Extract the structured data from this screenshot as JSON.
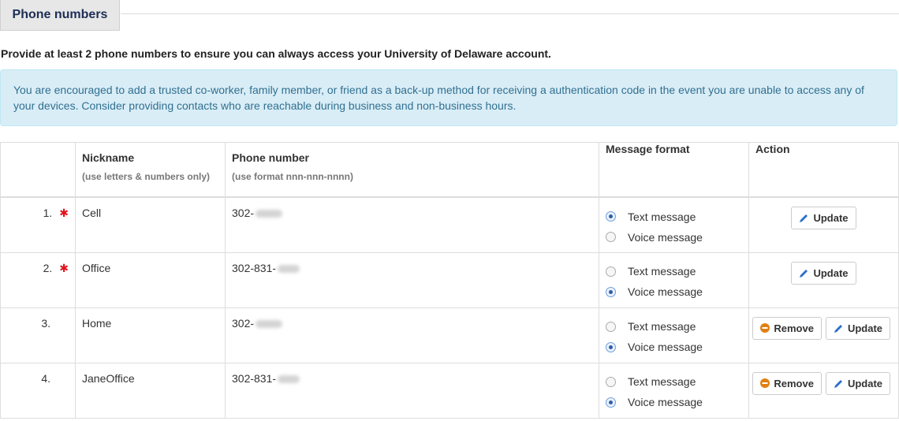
{
  "tab": {
    "label": "Phone numbers"
  },
  "intro": "Provide at least 2 phone numbers to ensure you can always access your University of Delaware account.",
  "alert": "You are encouraged to add a trusted co-worker, family member, or friend as a back-up method for receiving a authentication code in the event you are unable to access any of your devices. Consider providing contacts who are reachable during business and non-business hours.",
  "table": {
    "headers": {
      "nickname": "Nickname",
      "nickname_hint": "(use letters & numbers only)",
      "phone": "Phone number",
      "phone_hint": "(use format nnn-nnn-nnnn)",
      "format": "Message format",
      "action": "Action"
    },
    "options": {
      "text": "Text message",
      "voice": "Voice message"
    },
    "buttons": {
      "update": "Update",
      "remove": "Remove"
    },
    "rows": [
      {
        "num": "1.",
        "nickname": "Cell",
        "phone_prefix": "302-",
        "format": "text",
        "required": true
      },
      {
        "num": "2.",
        "nickname": "Office",
        "phone_prefix": "302-831-",
        "format": "voice",
        "required": true
      },
      {
        "num": "3.",
        "nickname": "Home",
        "phone_prefix": "302-",
        "format": "voice",
        "required": false
      },
      {
        "num": "4.",
        "nickname": "JaneOffice",
        "phone_prefix": "302-831-",
        "format": "voice",
        "required": false
      }
    ]
  },
  "colors": {
    "required_star": "#e0141e",
    "remove_icon": "#e07f12",
    "update_icon": "#2a6fc9",
    "alert_bg": "#d9edf7"
  }
}
